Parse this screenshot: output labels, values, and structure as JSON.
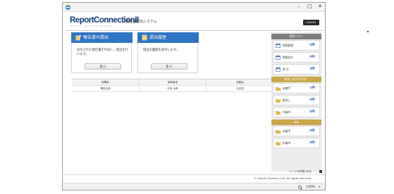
{
  "browser": {
    "window_buttons": {
      "minimize": "–",
      "maximize": "□",
      "close": "✕"
    },
    "zoom": "130%",
    "zoom_arrow": "▾"
  },
  "header": {
    "logo": "ReportConnectionII",
    "logo_subtitle": "Report Output System",
    "system_name": "報告書提出システム",
    "logout_label": "LOGOUT"
  },
  "cards": [
    {
      "title": "報告書の提出",
      "description": "記号された報告書を作成し、提出を行います。",
      "button_label": "実 行",
      "button_arrow": "›"
    },
    {
      "title": "提出履歴",
      "description": "提出の履歴を表示します。",
      "button_label": "実 行",
      "button_arrow": "›"
    }
  ],
  "summary": {
    "headers": [
      "部署名",
      "使用者名",
      "自動名"
    ],
    "row": [
      "第百元部",
      "日本 太郎",
      "元自名"
    ]
  },
  "sidebar": {
    "sections": [
      {
        "title": "提出リスト",
        "items": [
          {
            "label": "期限超過",
            "count": "0件"
          },
          {
            "label": "期限切れ",
            "count": "0件"
          },
          {
            "label": "前 月",
            "count": "3件"
          }
        ]
      },
      {
        "title": "報告（自分が作成）",
        "items": [
          {
            "label": "未着手",
            "count": "1件"
          },
          {
            "label": "差戻し",
            "count": "0件"
          },
          {
            "label": "作業中",
            "count": "0件"
          }
        ]
      },
      {
        "title": "承認",
        "items": [
          {
            "label": "未着手",
            "count": "0件"
          },
          {
            "label": "作業中",
            "count": "0件"
          }
        ]
      }
    ]
  },
  "footer": {
    "top_link": "ページの先頭に戻る",
    "copyright": "© Hitachi Systems, Ltd. All rights reserved."
  },
  "colors": {
    "card_header": "#2f74c4",
    "logo": "#0c3b78",
    "sidebar_header_dark": "#7d7d7d",
    "sidebar_header_gold": "#c8a64a",
    "count": "#2f5fa8"
  }
}
